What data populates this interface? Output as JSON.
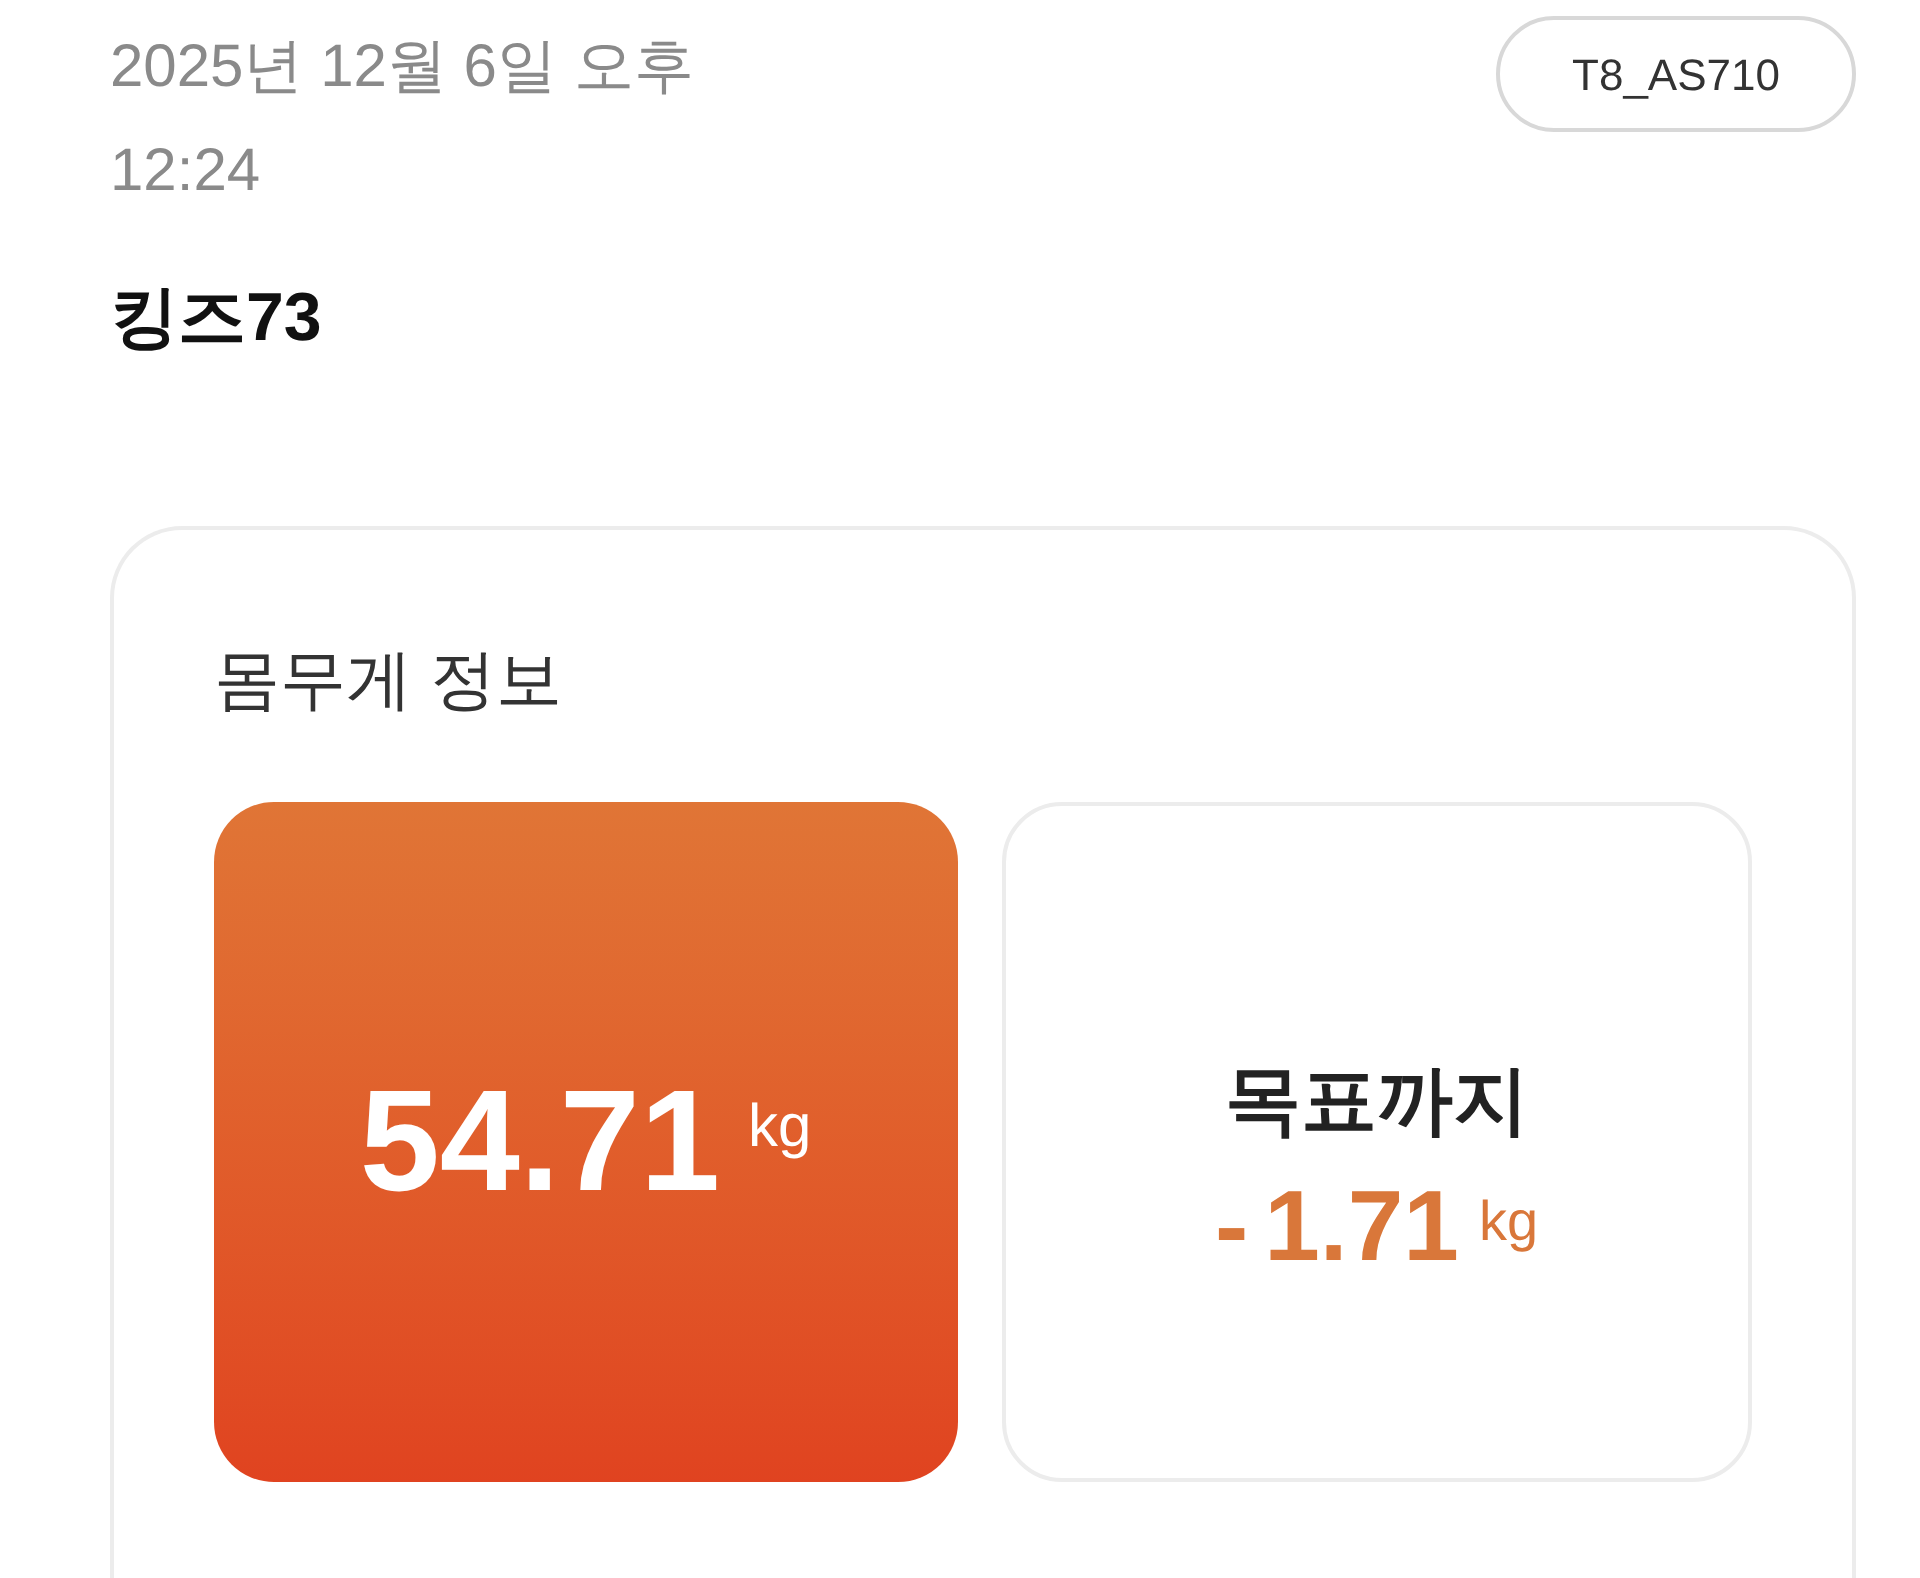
{
  "header": {
    "datetime": "2025년 12월 6일 오후\n12:24",
    "device_badge": "T8_AS710",
    "user_name": "킹즈73"
  },
  "weight_card": {
    "title": "몸무게 정보",
    "current": {
      "value": "54.71",
      "unit": "kg"
    },
    "goal": {
      "label": "목표까지",
      "sign": "-",
      "value": "1.71",
      "unit": "kg"
    }
  }
}
